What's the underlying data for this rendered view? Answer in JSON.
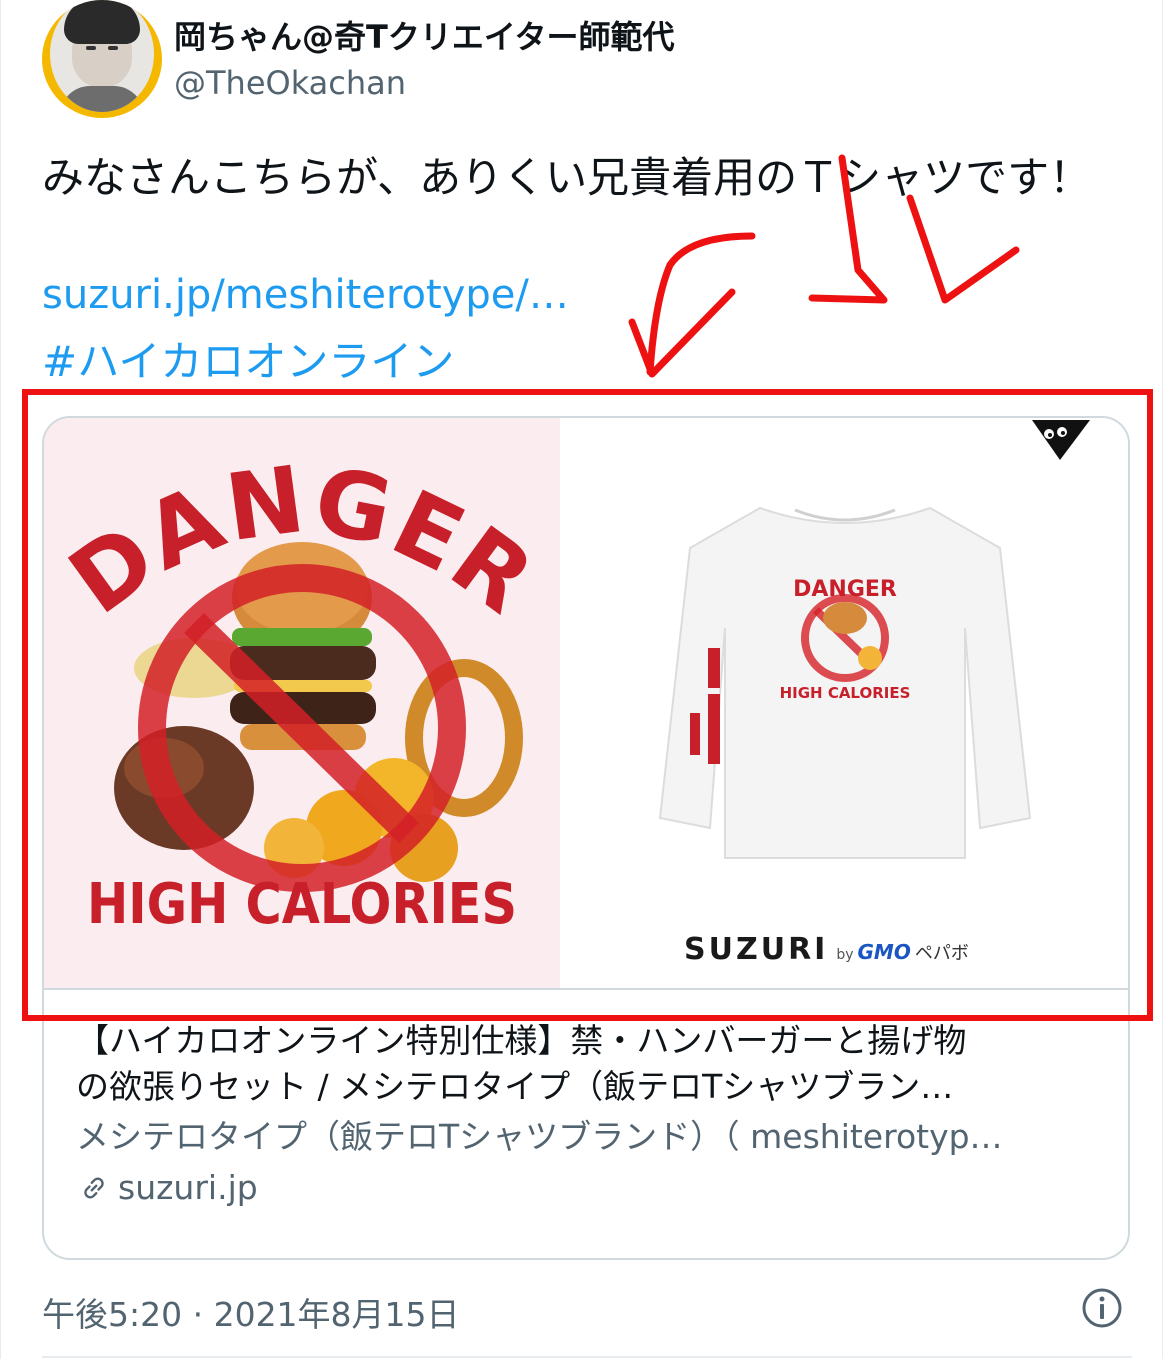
{
  "author": {
    "display_name": "岡ちゃん@奇Tクリエイター師範代",
    "handle": "@TheOkachan"
  },
  "tweet": {
    "text": "みなさんこちらが、ありくい兄貴着用のＴシャツです！",
    "link": "suzuri.jp/meshiterotype/…",
    "hashtag": "#ハイカロオンライン",
    "timestamp": "午後5:20 · 2021年8月15日"
  },
  "card": {
    "image_left": {
      "top_text": "DANGER",
      "bottom_text": "HIGH CALORIES"
    },
    "image_right": {
      "shirt_top_text": "DANGER",
      "shirt_bottom_text": "HIGH CALORIES",
      "brand": "SUZURI",
      "brand_by": "by",
      "brand_gmo": "GMO",
      "brand_pepabo": "ペパボ"
    },
    "title_line1": "【ハイカロオンライン特別仕様】禁・ハンバーガーと揚げ物",
    "title_line2": "の欲張りセット / メシテロタイプ（飯テロTシャツブラン…",
    "description": "メシテロタイプ（飯テロTシャツブランド）（ meshiterotyp…",
    "domain": "suzuri.jp"
  },
  "colors": {
    "link": "#1d9bf0",
    "secondary_text": "#536471",
    "annotation": "#ee1111",
    "danger_red": "#c8202a"
  },
  "icons": [
    "link-icon",
    "info-icon"
  ]
}
